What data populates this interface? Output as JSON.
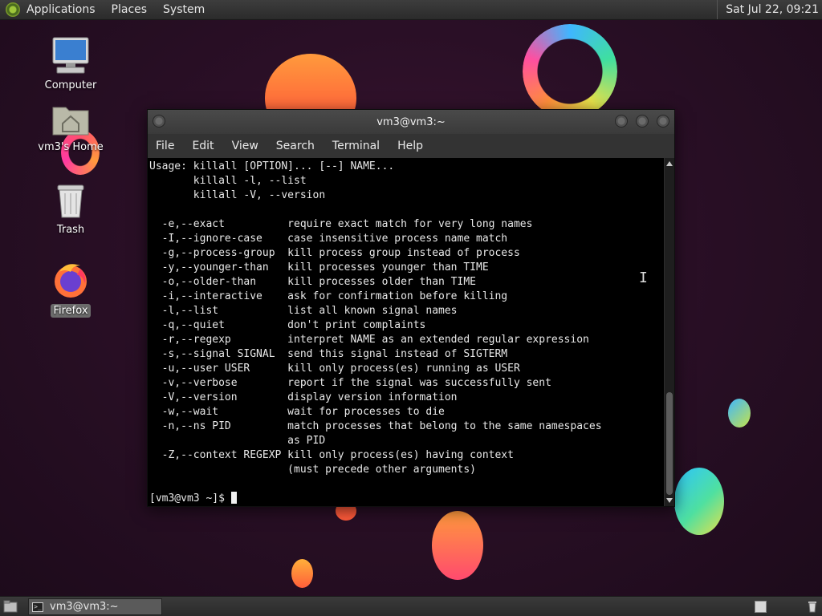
{
  "top_panel": {
    "menus": [
      "Applications",
      "Places",
      "System"
    ],
    "clock": "Sat Jul 22, 09:21"
  },
  "desktop_icons": [
    {
      "label": "Computer",
      "icon": "computer-icon"
    },
    {
      "label": "vm3's Home",
      "icon": "home-folder-icon"
    },
    {
      "label": "Trash",
      "icon": "trash-icon"
    },
    {
      "label": "Firefox",
      "icon": "firefox-icon"
    }
  ],
  "terminal": {
    "title": "vm3@vm3:~",
    "menu": [
      "File",
      "Edit",
      "View",
      "Search",
      "Terminal",
      "Help"
    ],
    "lines": [
      "Usage: killall [OPTION]... [--] NAME...",
      "       killall -l, --list",
      "       killall -V, --version",
      "",
      "  -e,--exact          require exact match for very long names",
      "  -I,--ignore-case    case insensitive process name match",
      "  -g,--process-group  kill process group instead of process",
      "  -y,--younger-than   kill processes younger than TIME",
      "  -o,--older-than     kill processes older than TIME",
      "  -i,--interactive    ask for confirmation before killing",
      "  -l,--list           list all known signal names",
      "  -q,--quiet          don't print complaints",
      "  -r,--regexp         interpret NAME as an extended regular expression",
      "  -s,--signal SIGNAL  send this signal instead of SIGTERM",
      "  -u,--user USER      kill only process(es) running as USER",
      "  -v,--verbose        report if the signal was successfully sent",
      "  -V,--version        display version information",
      "  -w,--wait           wait for processes to die",
      "  -n,--ns PID         match processes that belong to the same namespaces",
      "                      as PID",
      "  -Z,--context REGEXP kill only process(es) having context",
      "                      (must precede other arguments)",
      ""
    ],
    "prompt": "[vm3@vm3 ~]$ "
  },
  "bottom_panel": {
    "task_label": "vm3@vm3:~"
  },
  "colors": {
    "panel": "#2b2b2b",
    "terminal_bg": "#000000",
    "terminal_fg": "#e8e8e8",
    "desktop_bg": "#2a0f26"
  }
}
